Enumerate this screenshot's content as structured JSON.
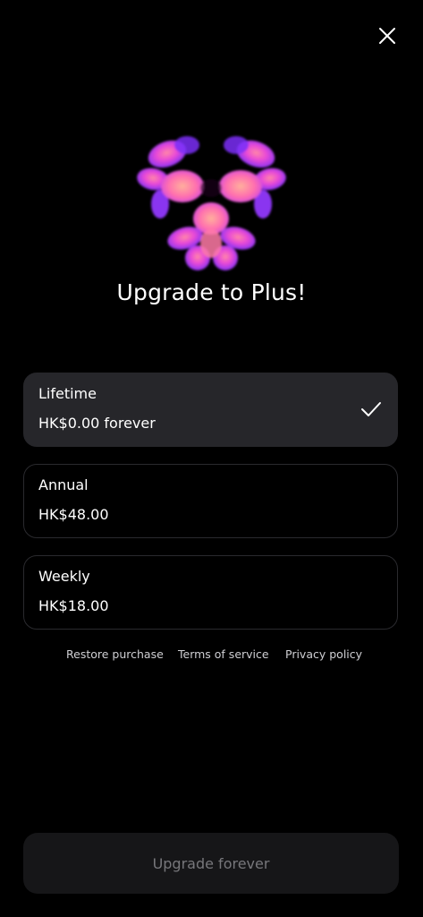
{
  "header": {
    "close_icon": "close-icon"
  },
  "hero": {
    "logo_icon": "app-logo-icon",
    "title": "Upgrade to Plus!"
  },
  "plans": [
    {
      "name": "Lifetime",
      "price": "HK$0.00 forever",
      "selected": true
    },
    {
      "name": "Annual",
      "price": "HK$48.00",
      "selected": false
    },
    {
      "name": "Weekly",
      "price": "HK$18.00",
      "selected": false
    }
  ],
  "links": {
    "restore": "Restore purchase",
    "terms": "Terms of service",
    "privacy": "Privacy policy"
  },
  "cta": {
    "label": "Upgrade forever"
  },
  "colors": {
    "background": "#000000",
    "selected_card": "#26262a",
    "card_border": "#2a2a2e",
    "cta_background": "#161618",
    "cta_text": "#77777b",
    "logo_purple": "#7b2ff7",
    "logo_pink": "#ff6fae"
  }
}
